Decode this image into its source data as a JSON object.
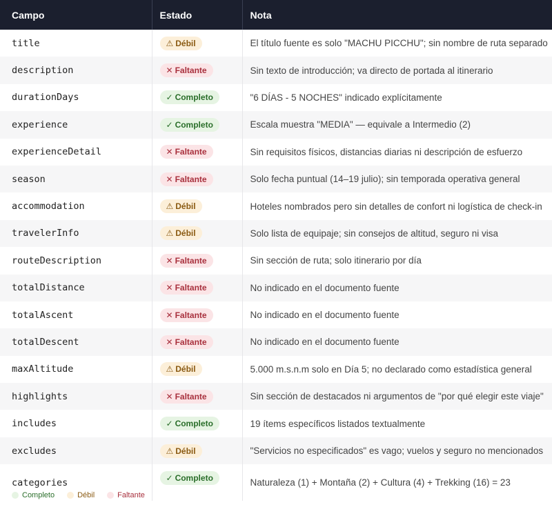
{
  "header": {
    "campo": "Campo",
    "estado": "Estado",
    "nota": "Nota"
  },
  "status_labels": {
    "ok": "Completo",
    "weak": "Débil",
    "missing": "Faltante"
  },
  "status_glyphs": {
    "ok": "✓",
    "weak": "⚠",
    "missing": "✕"
  },
  "colors": {
    "header_bg": "#1b1f2e",
    "ok": "#2a6e2a",
    "weak": "#8a5a12",
    "missing": "#a8303d"
  },
  "rows": [
    {
      "field": "title",
      "status": "weak",
      "note": "El título fuente es solo \"MACHU PICCHU\"; sin nombre de ruta separado"
    },
    {
      "field": "description",
      "status": "missing",
      "note": "Sin texto de introducción; va directo de portada al itinerario"
    },
    {
      "field": "durationDays",
      "status": "ok",
      "note": "\"6 DÍAS - 5 NOCHES\" indicado explícitamente"
    },
    {
      "field": "experience",
      "status": "ok",
      "note": "Escala muestra \"MEDIA\" — equivale a Intermedio (2)"
    },
    {
      "field": "experienceDetail",
      "status": "missing",
      "note": "Sin requisitos físicos, distancias diarias ni descripción de esfuerzo"
    },
    {
      "field": "season",
      "status": "missing",
      "note": "Solo fecha puntual (14–19 julio); sin temporada operativa general"
    },
    {
      "field": "accommodation",
      "status": "weak",
      "note": "Hoteles nombrados pero sin detalles de confort ni logística de check-in"
    },
    {
      "field": "travelerInfo",
      "status": "weak",
      "note": "Solo lista de equipaje; sin consejos de altitud, seguro ni visa"
    },
    {
      "field": "routeDescription",
      "status": "missing",
      "note": "Sin sección de ruta; solo itinerario por día"
    },
    {
      "field": "totalDistance",
      "status": "missing",
      "note": "No indicado en el documento fuente"
    },
    {
      "field": "totalAscent",
      "status": "missing",
      "note": "No indicado en el documento fuente"
    },
    {
      "field": "totalDescent",
      "status": "missing",
      "note": "No indicado en el documento fuente"
    },
    {
      "field": "maxAltitude",
      "status": "weak",
      "note": "5.000 m.s.n.m solo en Día 5; no declarado como estadística general"
    },
    {
      "field": "highlights",
      "status": "missing",
      "note": "Sin sección de destacados ni argumentos de \"por qué elegir este viaje\""
    },
    {
      "field": "includes",
      "status": "ok",
      "note": "19 ítems específicos listados textualmente"
    },
    {
      "field": "excludes",
      "status": "weak",
      "note": "\"Servicios no especificados\" es vago; vuelos y seguro no mencionados"
    },
    {
      "field": "categories",
      "status": "ok",
      "note": "Naturaleza (1) + Montaña (2) + Cultura (4) + Trekking (16) = 23"
    }
  ],
  "legend": [
    {
      "status": "ok",
      "label": "Completo"
    },
    {
      "status": "weak",
      "label": "Débil"
    },
    {
      "status": "missing",
      "label": "Faltante"
    }
  ]
}
